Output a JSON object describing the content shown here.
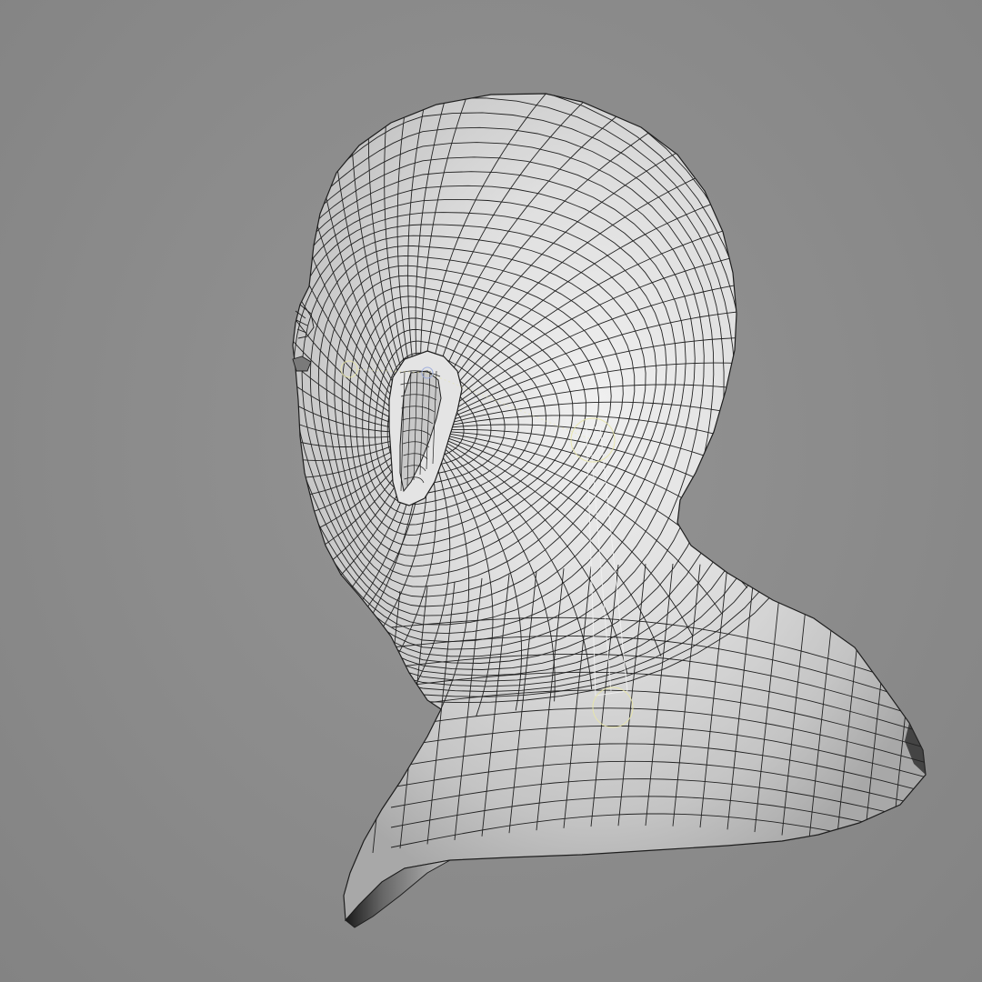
{
  "scene": {
    "subject": "head-neck-shoulder-wireframe-mesh",
    "display_mode": "wireframe-on-shaded",
    "colors": {
      "background": "#8a8a8a",
      "surface": "#d6d6d6",
      "surface_highlight": "#ececec",
      "surface_shadow": "#9c9c9c",
      "wire": "#1e1e1e",
      "rig_joint": "#e8e6a8",
      "rig_bone": "#f0f0f0"
    },
    "icons": [
      "rig-joint-icon"
    ]
  }
}
